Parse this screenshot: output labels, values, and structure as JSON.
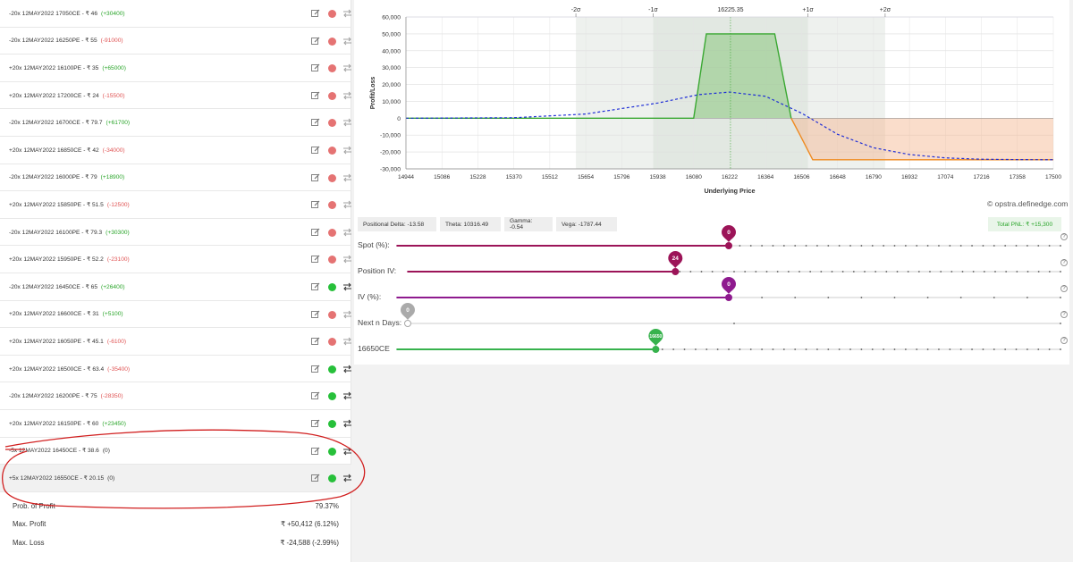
{
  "legs": [
    {
      "text": "-20x  12MAY2022  17050CE  - ₹ 46",
      "pnl": "(+30400)",
      "pnl_sign": "pos",
      "status": "red"
    },
    {
      "text": "-20x  12MAY2022  16250PE  - ₹ 55",
      "pnl": "(-91000)",
      "pnl_sign": "neg",
      "status": "red"
    },
    {
      "text": "+20x  12MAY2022  16100PE  - ₹ 35",
      "pnl": "(+65000)",
      "pnl_sign": "pos",
      "status": "red"
    },
    {
      "text": "+20x  12MAY2022  17200CE  - ₹ 24",
      "pnl": "(-15500)",
      "pnl_sign": "neg",
      "status": "red"
    },
    {
      "text": "-20x  12MAY2022  16700CE  - ₹ 79.7",
      "pnl": "(+61700)",
      "pnl_sign": "pos",
      "status": "red"
    },
    {
      "text": "+20x  12MAY2022  16850CE  - ₹ 42",
      "pnl": "(-34000)",
      "pnl_sign": "neg",
      "status": "red"
    },
    {
      "text": "-20x  12MAY2022  16000PE  - ₹ 79",
      "pnl": "(+18900)",
      "pnl_sign": "pos",
      "status": "red"
    },
    {
      "text": "+20x  12MAY2022  15850PE  - ₹ 51.5",
      "pnl": "(-12500)",
      "pnl_sign": "neg",
      "status": "red"
    },
    {
      "text": "-20x  12MAY2022  16100PE  - ₹ 79.3",
      "pnl": "(+30300)",
      "pnl_sign": "pos",
      "status": "red"
    },
    {
      "text": "+20x  12MAY2022  15950PE  - ₹ 52.2",
      "pnl": "(-23100)",
      "pnl_sign": "neg",
      "status": "red"
    },
    {
      "text": "-20x  12MAY2022  16450CE  - ₹ 65",
      "pnl": "(+26400)",
      "pnl_sign": "pos",
      "status": "green"
    },
    {
      "text": "+20x  12MAY2022  16600CE  - ₹ 31",
      "pnl": "(+5100)",
      "pnl_sign": "pos",
      "status": "red"
    },
    {
      "text": "+20x  12MAY2022  16050PE  - ₹ 45.1",
      "pnl": "(-6100)",
      "pnl_sign": "neg",
      "status": "red"
    },
    {
      "text": "+20x  12MAY2022  16500CE  - ₹ 63.4",
      "pnl": "(-35400)",
      "pnl_sign": "neg",
      "status": "green"
    },
    {
      "text": "-20x  12MAY2022  16200PE  - ₹ 75",
      "pnl": "(-28350)",
      "pnl_sign": "neg",
      "status": "green"
    },
    {
      "text": "+20x  12MAY2022  16150PE  - ₹ 60",
      "pnl": "(+23450)",
      "pnl_sign": "pos",
      "status": "green"
    },
    {
      "text": "-5x  12MAY2022  16450CE  - ₹ 38.6",
      "pnl": "(0)",
      "pnl_sign": "zero",
      "status": "green"
    },
    {
      "text": "+5x  12MAY2022  16550CE  - ₹ 20.15",
      "pnl": "(0)",
      "pnl_sign": "zero",
      "status": "green"
    }
  ],
  "summary": [
    {
      "label": "Prob. of Profit",
      "value": "79.37%"
    },
    {
      "label": "Max. Profit",
      "value": "₹ +50,412 (6.12%)"
    },
    {
      "label": "Max. Loss",
      "value": "₹ -24,588 (-2.99%)"
    }
  ],
  "chart_data": {
    "type": "line",
    "xlabel": "Underlying Price",
    "ylabel": "Profit/Loss",
    "xlim": [
      14944,
      17500
    ],
    "ylim": [
      -30000,
      60000
    ],
    "x_ticks": [
      14944,
      15086,
      15228,
      15370,
      15512,
      15654,
      15796,
      15938,
      16080,
      16222,
      16364,
      16506,
      16648,
      16790,
      16932,
      17074,
      17216,
      17358,
      17500
    ],
    "y_ticks": [
      "60,000",
      "50,000",
      "40,000",
      "30,000",
      "20,000",
      "10,000",
      "0",
      "-10,000",
      "-20,000",
      "-30,000"
    ],
    "spot_label": "16225.35",
    "spot": 16225.35,
    "sigma_bands": [
      {
        "label": "-2σ",
        "x": 15615
      },
      {
        "label": "-1σ",
        "x": 15920
      },
      {
        "label": "+1σ",
        "x": 16531
      },
      {
        "label": "+2σ",
        "x": 16836
      }
    ],
    "series": [
      {
        "color": "#3aa832",
        "points": [
          [
            14944,
            0
          ],
          [
            16080,
            0
          ],
          [
            16130,
            50000
          ],
          [
            16400,
            50000
          ],
          [
            16465,
            0
          ],
          [
            16500,
            -10000
          ],
          [
            16550,
            -24588
          ],
          [
            17500,
            -24588
          ]
        ]
      },
      {
        "color": "#1f2ed6",
        "style": "dashed",
        "points": [
          [
            14944,
            0
          ],
          [
            15370,
            300
          ],
          [
            15654,
            2500
          ],
          [
            15938,
            9000
          ],
          [
            16100,
            14000
          ],
          [
            16222,
            15500
          ],
          [
            16364,
            13000
          ],
          [
            16506,
            3000
          ],
          [
            16648,
            -9500
          ],
          [
            16790,
            -17500
          ],
          [
            16932,
            -21500
          ],
          [
            17074,
            -23500
          ],
          [
            17216,
            -24300
          ],
          [
            17358,
            -24500
          ],
          [
            17500,
            -24588
          ]
        ]
      }
    ],
    "credit": "opstra.definedge.com"
  },
  "greeks": [
    {
      "label": "Positional Delta: -13.58"
    },
    {
      "label": "Theta: 10316.49"
    },
    {
      "label": "Gamma: -0.54"
    },
    {
      "label": "Vega: -1787.44"
    }
  ],
  "total_pnl": "Total PNL: ₹ +15,300",
  "sliders": [
    {
      "label": "Spot (%):",
      "value": "0",
      "color": "#9c1458",
      "fraction": 0.5
    },
    {
      "label": "Position IV:",
      "value": "24",
      "color": "#9c1458",
      "fraction": 0.41
    },
    {
      "label": "IV (%):",
      "value": "0",
      "color": "#8e1a8e",
      "fraction": 0.5
    },
    {
      "label": "Next n Days:",
      "value": "0",
      "color": "#aaaaaa",
      "fraction": 0.0
    },
    {
      "label": "16650CE",
      "value": "16650",
      "color": "#37b24d",
      "fraction": 0.39
    }
  ],
  "help_label": "?"
}
